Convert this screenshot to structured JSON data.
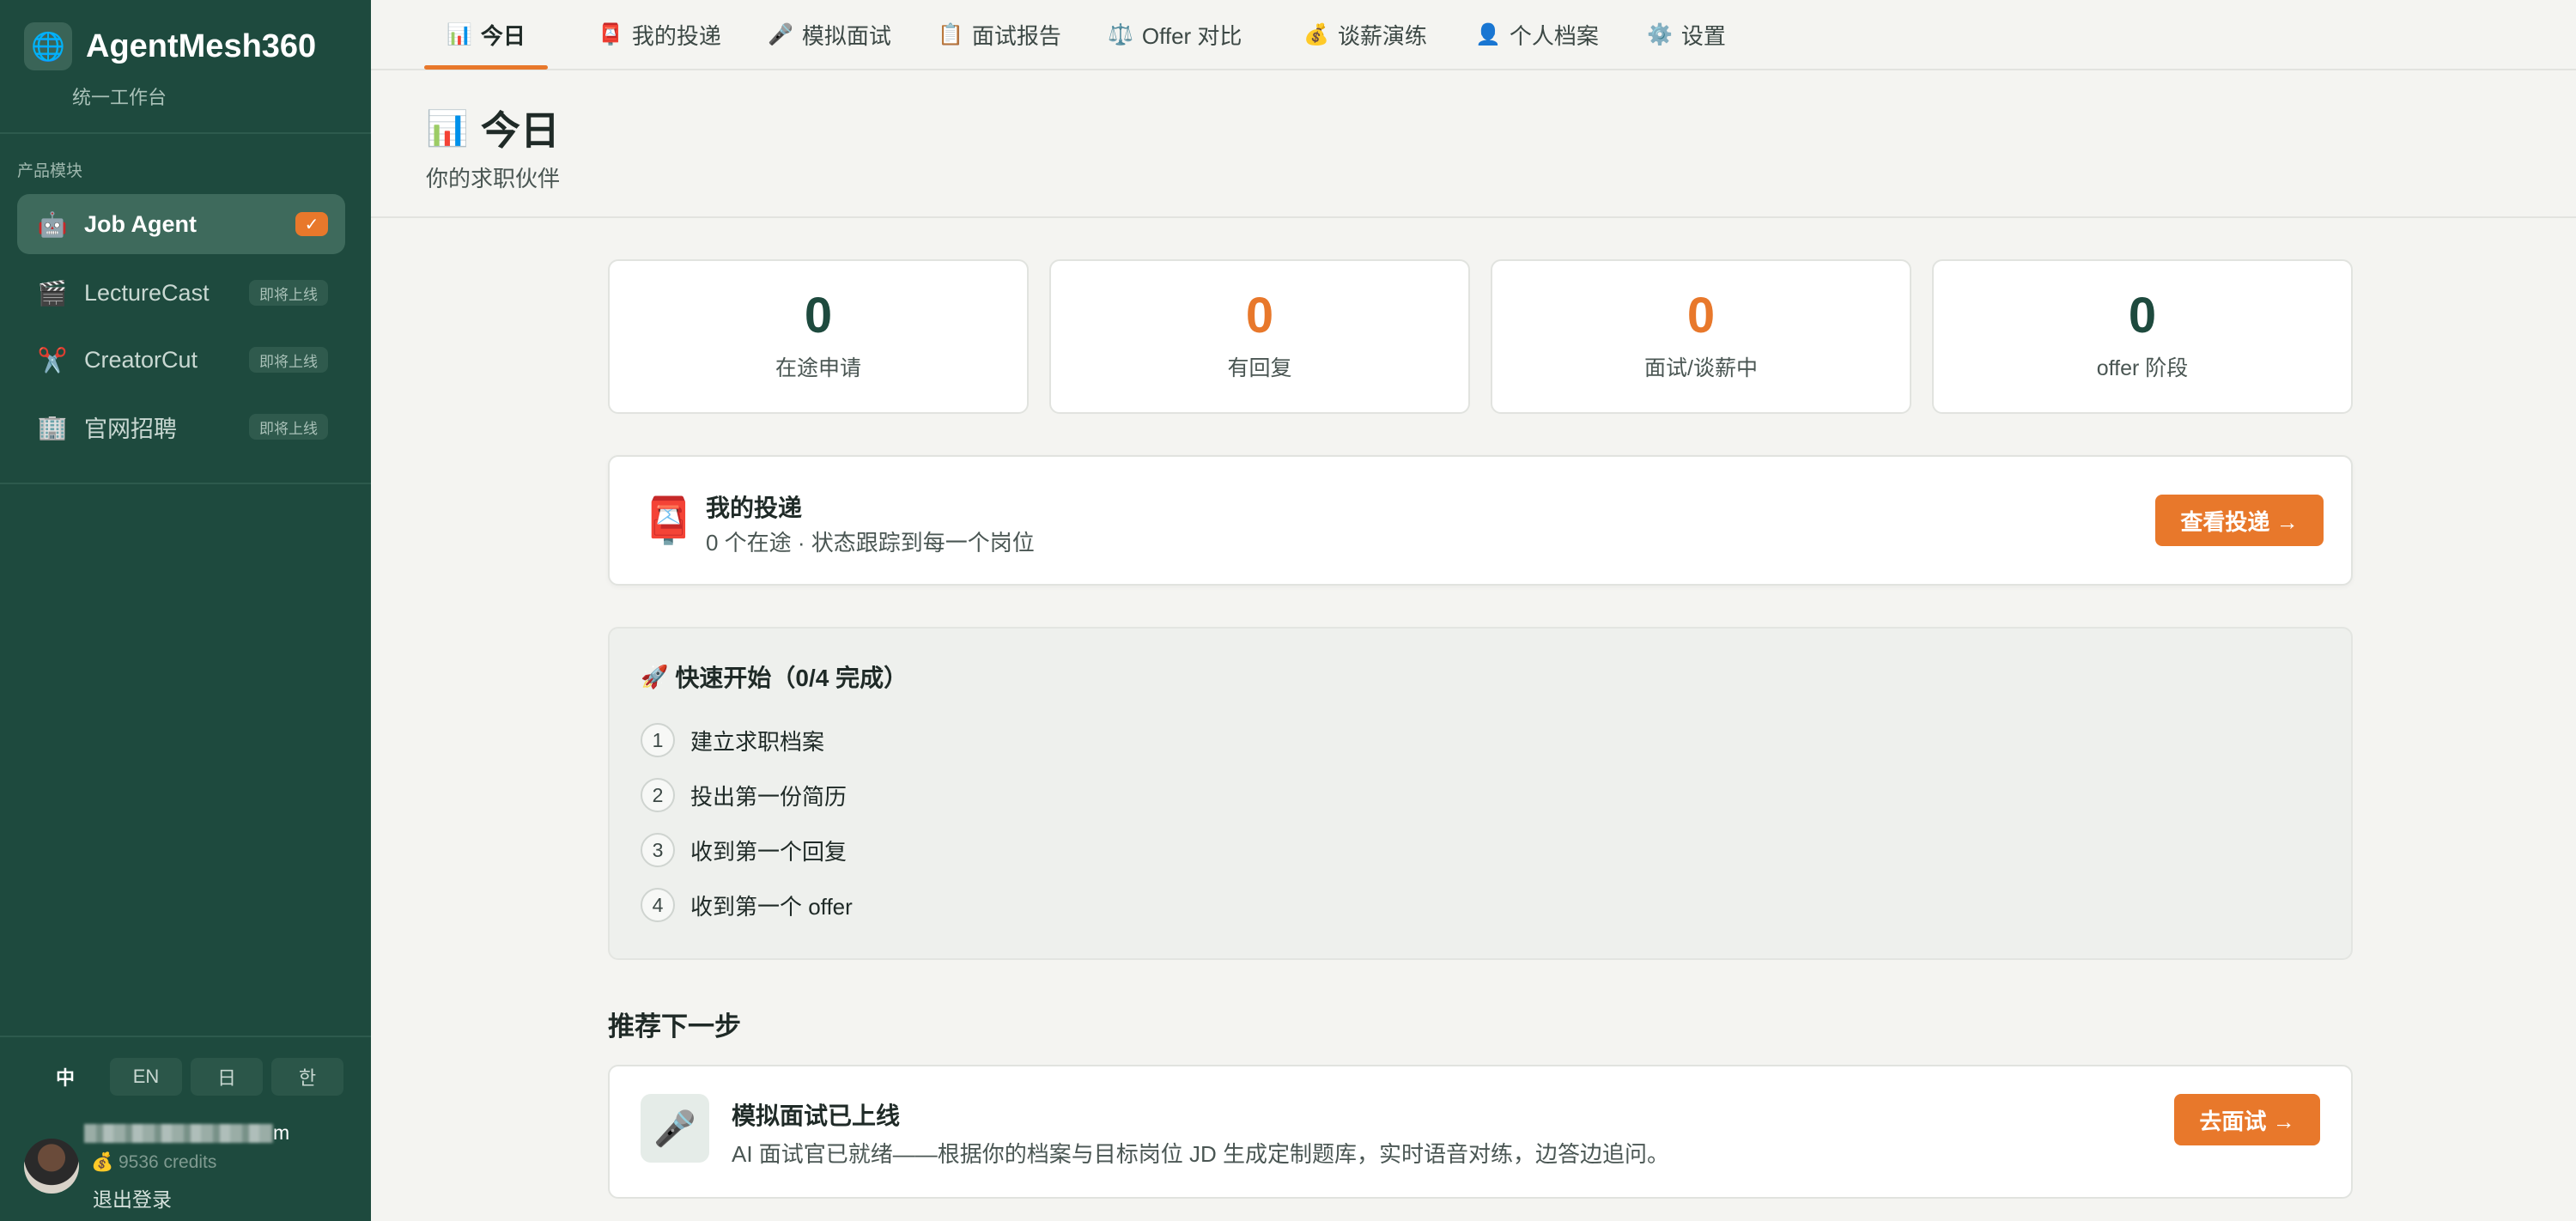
{
  "sidebar": {
    "brand": {
      "icon": "globe-icon",
      "title": "AgentMesh360",
      "subtitle": "统一工作台"
    },
    "section_label": "产品模块",
    "items": [
      {
        "icon": "robot-icon",
        "label": "Job Agent",
        "check": "✓"
      },
      {
        "icon": "clapper-icon",
        "label": "LectureCast",
        "badge": "即将上线"
      },
      {
        "icon": "scissors-icon",
        "label": "CreatorCut",
        "badge": "即将上线"
      },
      {
        "icon": "office-building-icon",
        "label": "官网招聘",
        "badge": "即将上线"
      }
    ],
    "languages": [
      "中",
      "EN",
      "日",
      "한"
    ],
    "user": {
      "name_suffix": "m",
      "credits": "💰 9536 credits",
      "logout": "退出登录"
    }
  },
  "tabs": [
    {
      "icon": "📊",
      "label": "今日"
    },
    {
      "icon": "📮",
      "label": "我的投递"
    },
    {
      "icon": "🎤",
      "label": "模拟面试"
    },
    {
      "icon": "📋",
      "label": "面试报告"
    },
    {
      "icon": "⚖️",
      "label": "Offer 对比"
    },
    {
      "icon": "💰",
      "label": "谈薪演练"
    },
    {
      "icon": "👤",
      "label": "个人档案"
    },
    {
      "icon": "⚙️",
      "label": "设置"
    }
  ],
  "page": {
    "icon": "📊",
    "title": "今日",
    "subtitle": "你的求职伙伴"
  },
  "stats": [
    {
      "value": "0",
      "label": "在途申请"
    },
    {
      "value": "0",
      "label": "有回复"
    },
    {
      "value": "0",
      "label": "面试/谈薪中"
    },
    {
      "value": "0",
      "label": "offer 阶段"
    }
  ],
  "delivery": {
    "icon": "📮",
    "title": "我的投递",
    "subtitle": "0 个在途 · 状态跟踪到每一个岗位",
    "button": "查看投递 →"
  },
  "quick_start": {
    "icon": "🚀",
    "title": "快速开始（0/4 完成）",
    "steps": [
      {
        "num": "1",
        "label": "建立求职档案"
      },
      {
        "num": "2",
        "label": "投出第一份简历"
      },
      {
        "num": "3",
        "label": "收到第一个回复"
      },
      {
        "num": "4",
        "label": "收到第一个 offer"
      }
    ]
  },
  "recommend": {
    "heading": "推荐下一步",
    "icon": "🎤",
    "title": "模拟面试已上线",
    "desc": "AI 面试官已就绪——根据你的档案与目标岗位 JD 生成定制题库，实时语音对练，边答边追问。",
    "button": "去面试 →"
  },
  "colors": {
    "sidebar": "#1e4a3e",
    "accent": "#e8782b",
    "background": "#f4f4f1"
  }
}
